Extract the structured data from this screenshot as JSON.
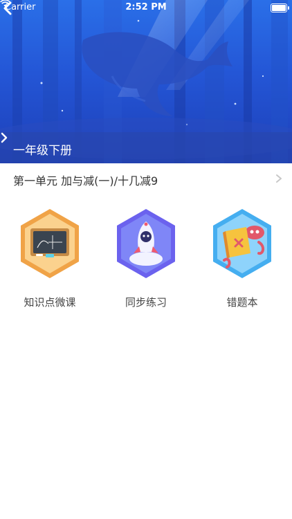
{
  "status": {
    "carrier": "Carrier",
    "time": "2:52 PM"
  },
  "banner": {
    "grade_label": "一年级下册"
  },
  "unit": {
    "label": "第一单元 加与减(一)/十几减9"
  },
  "features": [
    {
      "label": "知识点微课",
      "icon": "blackboard-icon"
    },
    {
      "label": "同步练习",
      "icon": "rocket-icon"
    },
    {
      "label": "错题本",
      "icon": "book-octopus-icon"
    }
  ],
  "colors": {
    "banner_top": "#2a6fe8",
    "banner_bottom": "#1d3fb8",
    "orange": "#f3a64a",
    "indigo": "#6f6bf0",
    "sky": "#4fb6f2"
  }
}
